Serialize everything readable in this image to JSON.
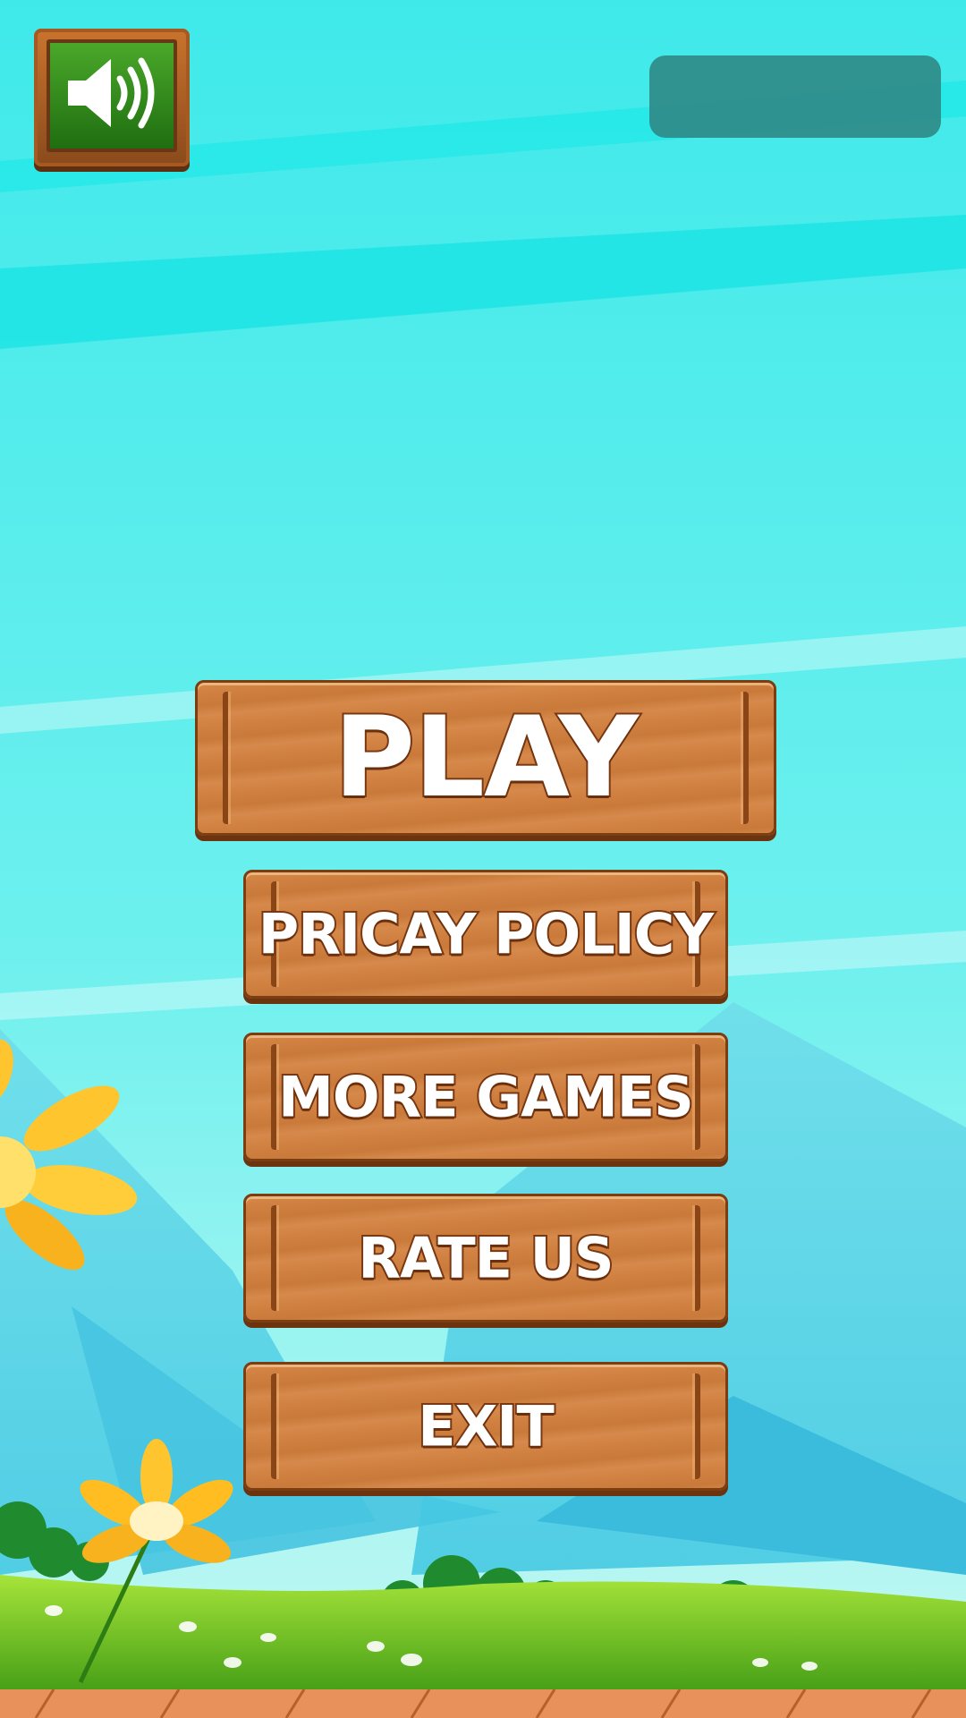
{
  "top_bar": {
    "sound_icon": "speaker-volume-icon",
    "sound_bg_color": "#2e8a18"
  },
  "menu": {
    "play_label": "PLAY",
    "privacy_label": "PRICAY POLICY",
    "more_games_label": "MORE GAMES",
    "rate_us_label": "RATE US",
    "exit_label": "EXIT"
  },
  "colors": {
    "sky_top": "#12e6e4",
    "sky_bottom": "#b8f6f4",
    "wood": "#cf8040",
    "wood_dark": "#7b3d12",
    "grass": "#6cc82a",
    "flower": "#ffc52e"
  }
}
